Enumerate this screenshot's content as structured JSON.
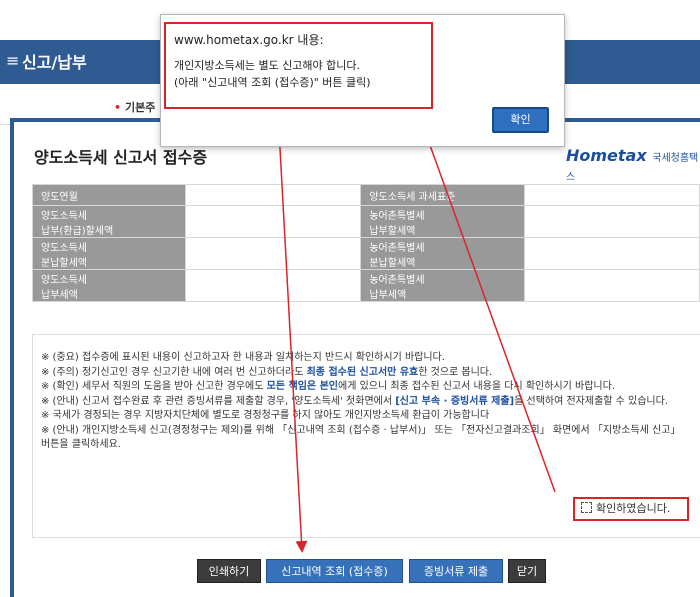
{
  "header": {
    "title": "신고/납부"
  },
  "subnav": {
    "tab_label": "기본주"
  },
  "page": {
    "title": "양도소득세 신고서 접수증",
    "logo": "Hometax",
    "logo_sub": "국세청홈택스"
  },
  "summary_table": {
    "rows": [
      {
        "left_label": "양도연월",
        "right_label": "양도소득세 과세표준"
      },
      {
        "left_label": "양도소득세\n납부(환급)할세액",
        "right_label": "농어촌특별세\n납부할세액"
      },
      {
        "left_label": "양도소득세\n분납할세액",
        "right_label": "농어촌특별세\n분납할세액"
      },
      {
        "left_label": "양도소득세\n납부세액",
        "right_label": "농어촌특별세\n납부세액"
      }
    ]
  },
  "notice": {
    "l1": "※ (중요) 접수증에 표시된 내용이 신고하고자 한 내용과 일치하는지 반드시 확인하시기 바랍니다.",
    "l2a": "※ (주의) 정기신고인 경우 신고기한 내에 여러 번 신고하더라도 ",
    "l2b": "최종 접수된 신고서만 유효",
    "l2c": "한 것으로 봅니다.",
    "l3a": "※ (확인) 세무서 직원의 도움을 받아 신고한 경우에도 ",
    "l3b": "모든 책임은 본인",
    "l3c": "에게 있으니 최종 접수된 신고서 내용을 다시 확인하시기 바랍니다.",
    "l4a": "※ (안내) 신고서 접수완료 후 관련 증빙서류를 제출할 경우, '양도소득세' 첫화면에서 ",
    "l4b": "[신고 부속 · 증빙서류 제출]",
    "l4c": "을 선택하여 전자제출할 수 있습니다.",
    "l5": "※ 국세가 경정되는 경우 지방자치단체에 별도로 경정청구를 하지 않아도 개인지방소득세 환급이 가능합니다",
    "l6": "※ (안내) 개인지방소득세 신고(경정청구는 제외)를 위해 「신고내역 조회 (접수증 · 납부서)」 또는 「전자신고결과조회」 화면에서 「지방소득세 신고」 버튼을 클릭하세요."
  },
  "confirm_label": "확인하였습니다.",
  "buttons": {
    "print": "인쇄하기",
    "history": "신고내역 조회 (접수증)",
    "evidence": "증빙서류 제출",
    "close": "닫기"
  },
  "dialog": {
    "title": "www.hometax.go.kr 내용:",
    "line1": "개인지방소득세는 별도 신고해야 합니다.",
    "line2": "(아래 \"신고내역 조회 (접수증)\" 버튼 클릭)",
    "ok_label": "확인"
  },
  "colors": {
    "accent": "#2f5b93",
    "alert": "#d7262b",
    "button_blue": "#3771b9"
  }
}
